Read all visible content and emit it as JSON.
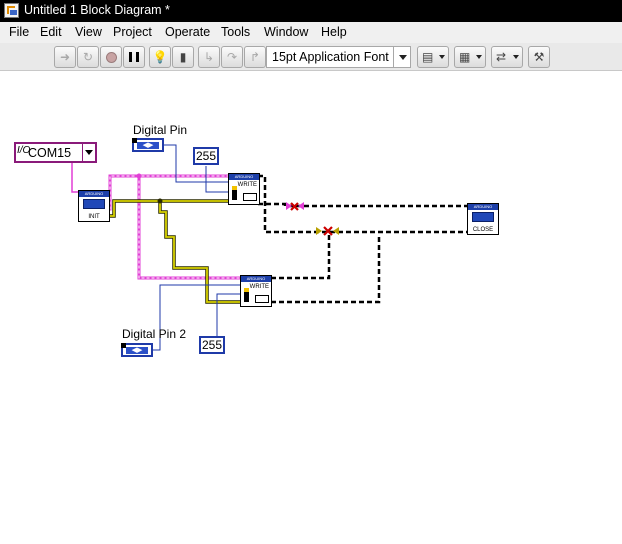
{
  "window": {
    "title": "Untitled 1 Block Diagram *"
  },
  "menu": [
    "File",
    "Edit",
    "View",
    "Project",
    "Operate",
    "Tools",
    "Window",
    "Help"
  ],
  "toolbar": {
    "font_label": "15pt Application Font",
    "icons": [
      "run-arrow-icon",
      "run-continuously-icon",
      "abort-icon",
      "pause-icon",
      "highlight-execution-icon",
      "retain-wire-values-icon",
      "step-into-icon",
      "step-over-icon",
      "step-out-icon",
      "align-objects-icon",
      "distribute-objects-icon",
      "reorder-icon",
      "clean-up-diagram-icon"
    ]
  },
  "diagram": {
    "visa_resource": "COM15",
    "digital_pin_label": "Digital Pin",
    "digital_pin_2_label": "Digital Pin 2",
    "const_1": "255",
    "const_2": "255",
    "init_caption": "INIT",
    "write_caption": "WRITE",
    "close_caption": "CLOSE",
    "header_text": "ARDUINO",
    "colors": {
      "visa_wire": "#e23fd6",
      "error_wire": "#d8d200",
      "broken_wire": "#000000",
      "numeric": "#1f3aa8"
    }
  }
}
